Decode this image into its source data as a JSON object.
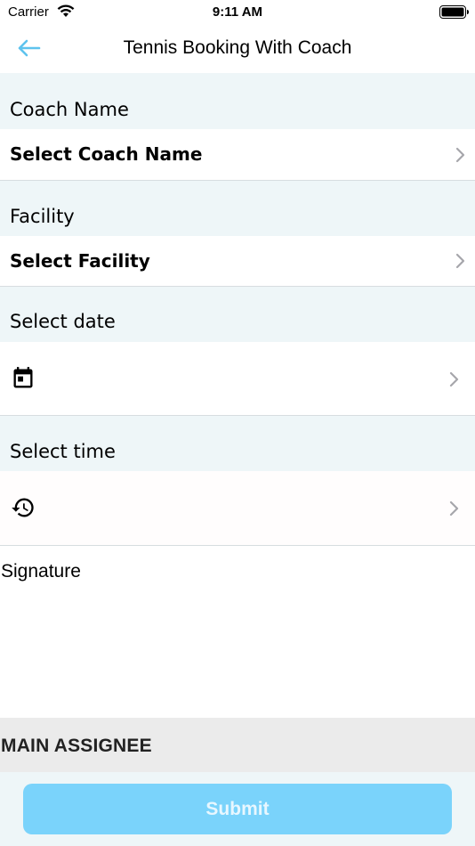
{
  "status_bar": {
    "carrier": "Carrier",
    "time": "9:11 AM"
  },
  "nav": {
    "title": "Tennis Booking With Coach",
    "back_icon": "arrow-left-icon"
  },
  "form": {
    "coach": {
      "label": "Coach Name",
      "value": "Select Coach Name"
    },
    "facility": {
      "label": "Facility",
      "value": "Select Facility"
    },
    "date": {
      "label": "Select date",
      "icon": "calendar-icon"
    },
    "time": {
      "label": "Select time",
      "icon": "history-icon"
    }
  },
  "signature": {
    "label": "Signature"
  },
  "assignee": {
    "label": "MAIN ASSIGNEE"
  },
  "submit": {
    "label": "Submit"
  },
  "colors": {
    "accent": "#7ad3fb",
    "section_bg": "#eef6f8",
    "back_arrow": "#5ec3ee",
    "assignee_bg": "#ebebeb"
  }
}
